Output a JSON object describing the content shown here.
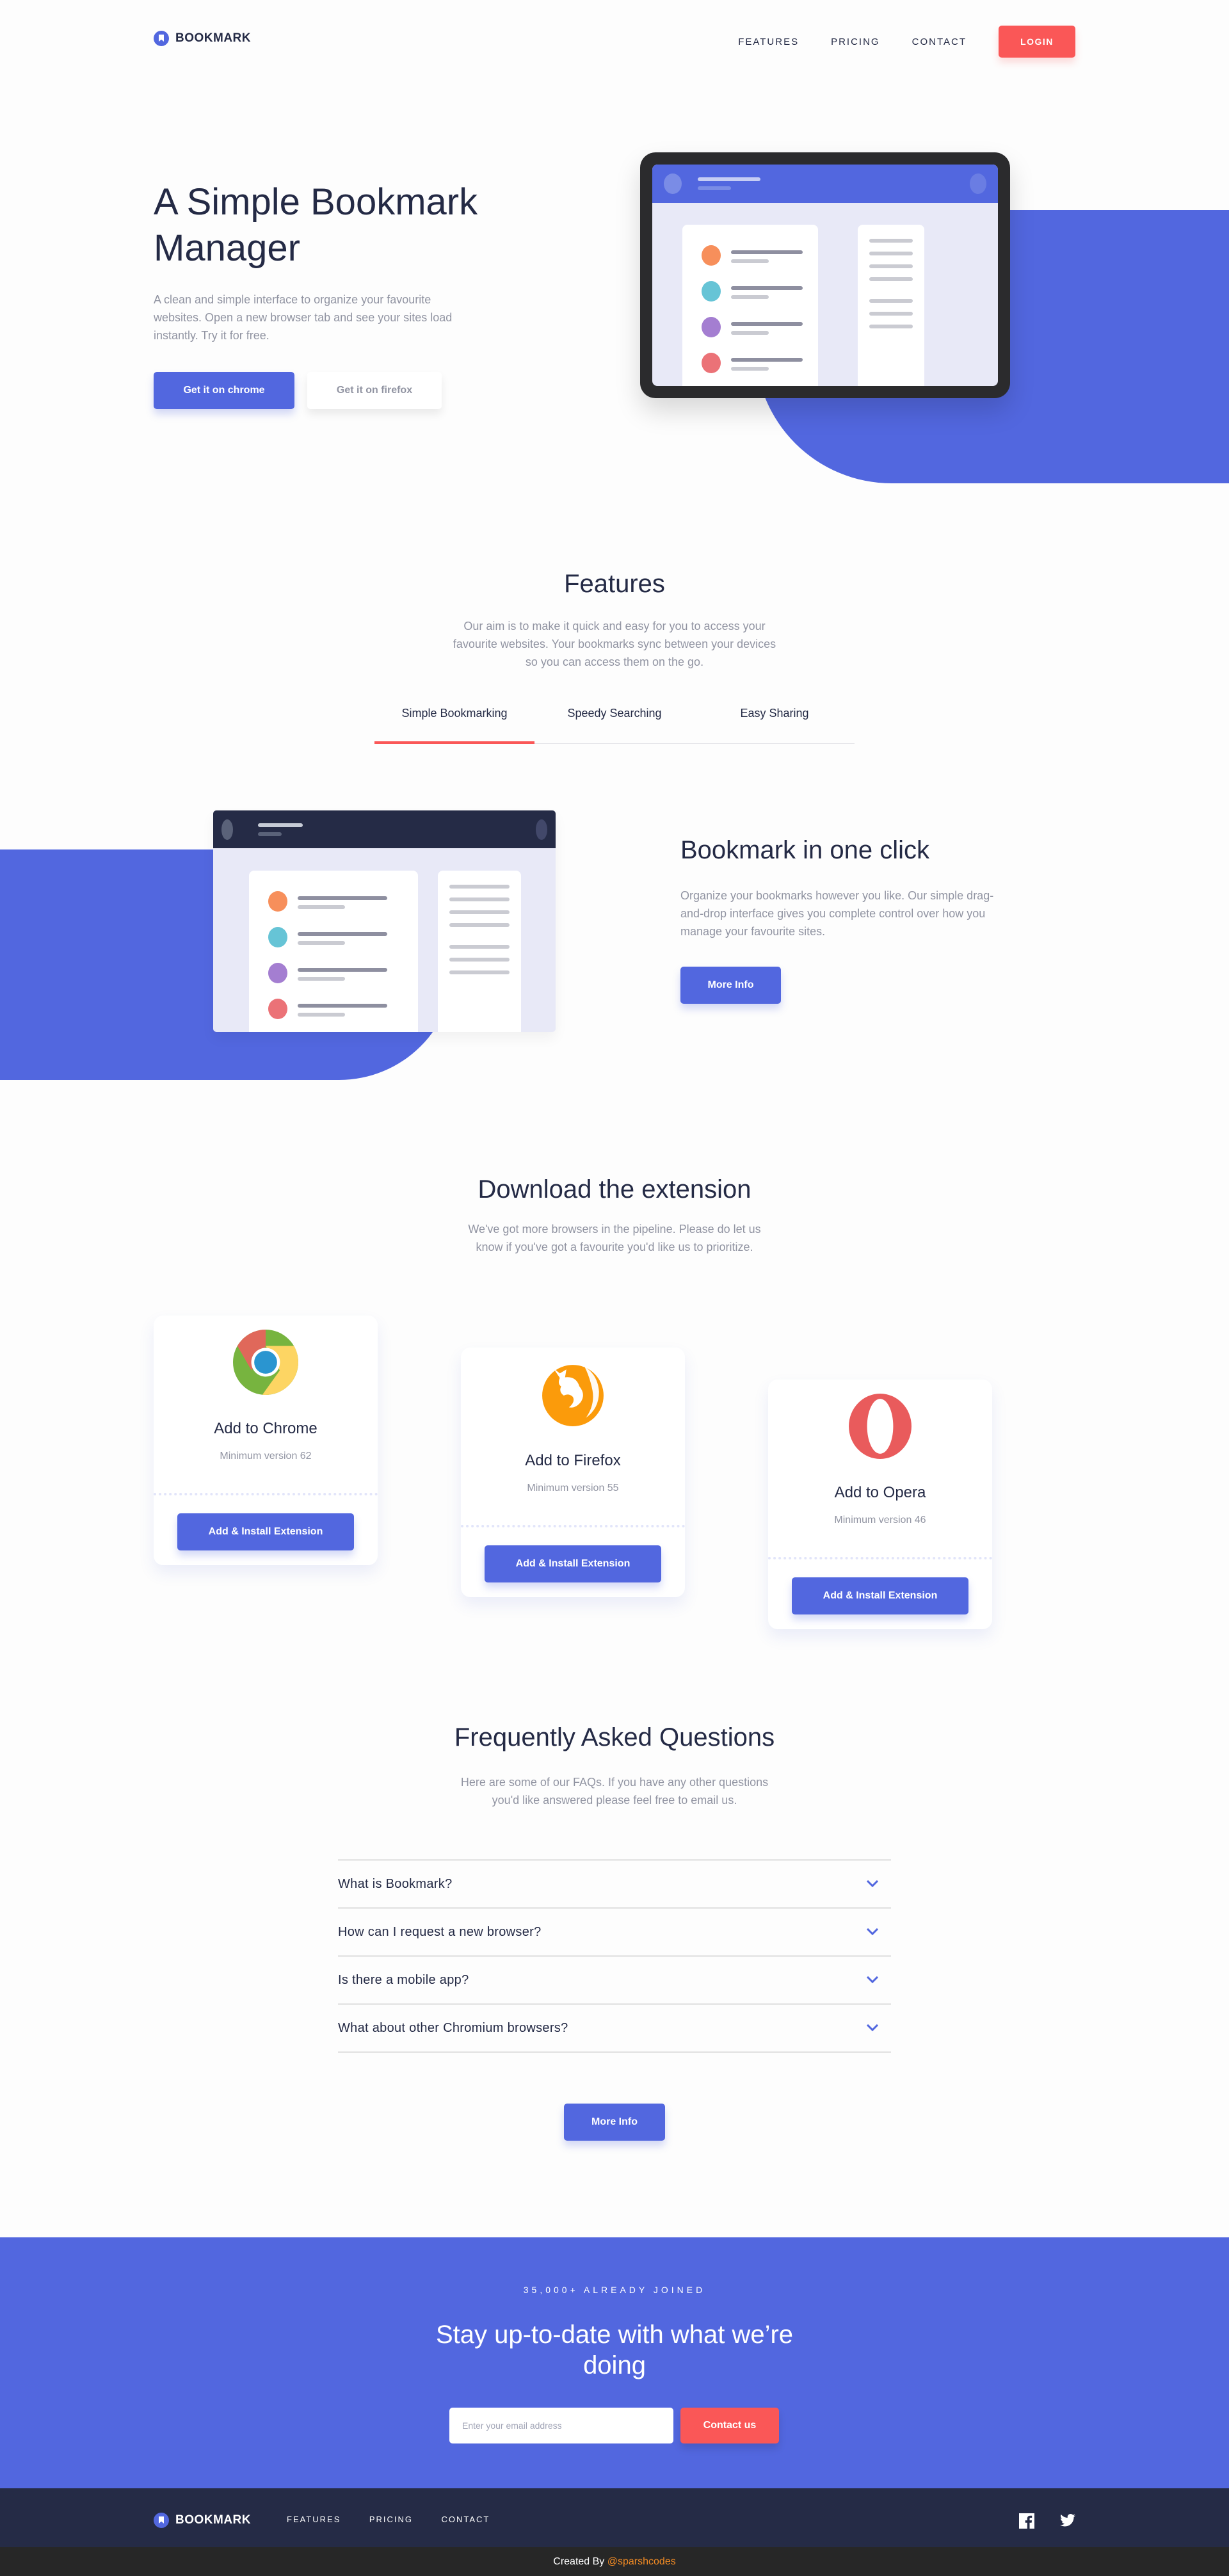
{
  "header": {
    "logo_text": "BOOKMARK",
    "nav": [
      "FEATURES",
      "PRICING",
      "CONTACT"
    ],
    "login_label": "LOGIN"
  },
  "hero": {
    "title": "A Simple Bookmark Manager",
    "text": "A clean and simple interface to organize your favourite websites. Open a new browser tab and see your sites load instantly. Try it for free.",
    "primary_button": "Get it on chrome",
    "secondary_button": "Get it on firefox"
  },
  "features": {
    "title": "Features",
    "text": "Our aim is to make it quick and easy for you to access your favourite websites. Your bookmarks sync between your devices so you can access them on the go.",
    "tabs": [
      {
        "label": "Simple Bookmarking",
        "active": true
      },
      {
        "label": "Speedy Searching",
        "active": false
      },
      {
        "label": "Easy Sharing",
        "active": false
      }
    ],
    "panel": {
      "title": "Bookmark in one click",
      "text": "Organize your bookmarks however you like. Our simple drag-and-drop interface gives you complete control over how you manage your favourite sites.",
      "button": "More Info"
    }
  },
  "illustration": {
    "dot_colors": [
      "#f78f5b",
      "#66c4d6",
      "#a47ed1",
      "#eb7277"
    ]
  },
  "download": {
    "title": "Download the extension",
    "text": "We've got more browsers in the pipeline. Please do let us know if you've got a favourite you'd like us to prioritize.",
    "cards": [
      {
        "icon": "chrome-logo-icon",
        "name": "Add to Chrome",
        "version": "Minimum version 62",
        "button": "Add & Install Extension"
      },
      {
        "icon": "firefox-logo-icon",
        "name": "Add to Firefox",
        "version": "Minimum version 55",
        "button": "Add & Install Extension"
      },
      {
        "icon": "opera-logo-icon",
        "name": "Add to Opera",
        "version": "Minimum version 46",
        "button": "Add & Install Extension"
      }
    ]
  },
  "faq": {
    "title": "Frequently Asked Questions",
    "text": "Here are some of our FAQs. If you have any other questions you'd like answered please feel free to email us.",
    "items": [
      "What is Bookmark?",
      "How can I request a new browser?",
      "Is there a mobile app?",
      "What about other Chromium browsers?"
    ],
    "button": "More Info"
  },
  "cta": {
    "kicker": "35,000+ ALREADY JOINED",
    "title": "Stay up-to-date with what we’re doing",
    "email_placeholder": "Enter your email address",
    "email_value": "",
    "button": "Contact us"
  },
  "footer": {
    "logo_text": "BOOKMARK",
    "nav": [
      "FEATURES",
      "PRICING",
      "CONTACT"
    ],
    "social": [
      "facebook-icon",
      "twitter-icon"
    ],
    "credit_prefix": "Created By ",
    "credit_handle": "@sparshcodes"
  },
  "colors": {
    "primary": "#5267df",
    "accent": "#fa5757",
    "dark": "#242a45",
    "grey": "#9194a2",
    "footer": "#252b46",
    "credit_bar": "#272727",
    "credit_link": "#f08a24"
  }
}
